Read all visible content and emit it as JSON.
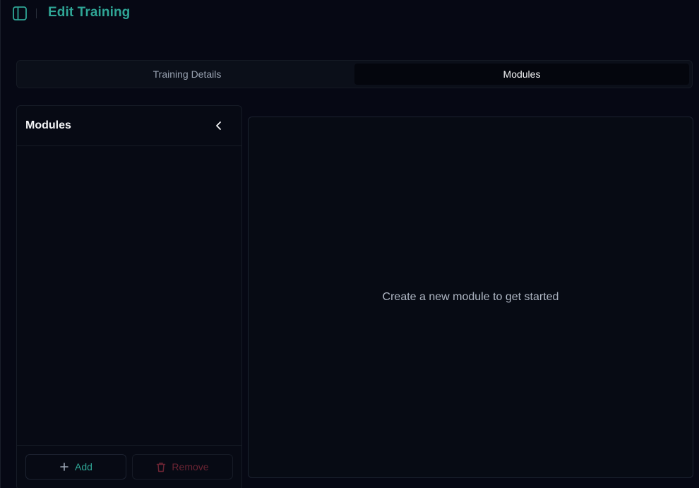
{
  "header": {
    "title": "Edit Training",
    "toggle_icon": "sidebar-panel-icon"
  },
  "tabs": [
    {
      "label": "Training Details",
      "active": false
    },
    {
      "label": "Modules",
      "active": true
    }
  ],
  "modules_panel": {
    "title": "Modules",
    "collapse_icon": "chevron-left-icon",
    "add_label": "Add",
    "remove_label": "Remove"
  },
  "main": {
    "empty_message": "Create a new module to get started"
  },
  "colors": {
    "accent": "#2fa696",
    "danger": "#6b2433",
    "background": "#060814"
  }
}
